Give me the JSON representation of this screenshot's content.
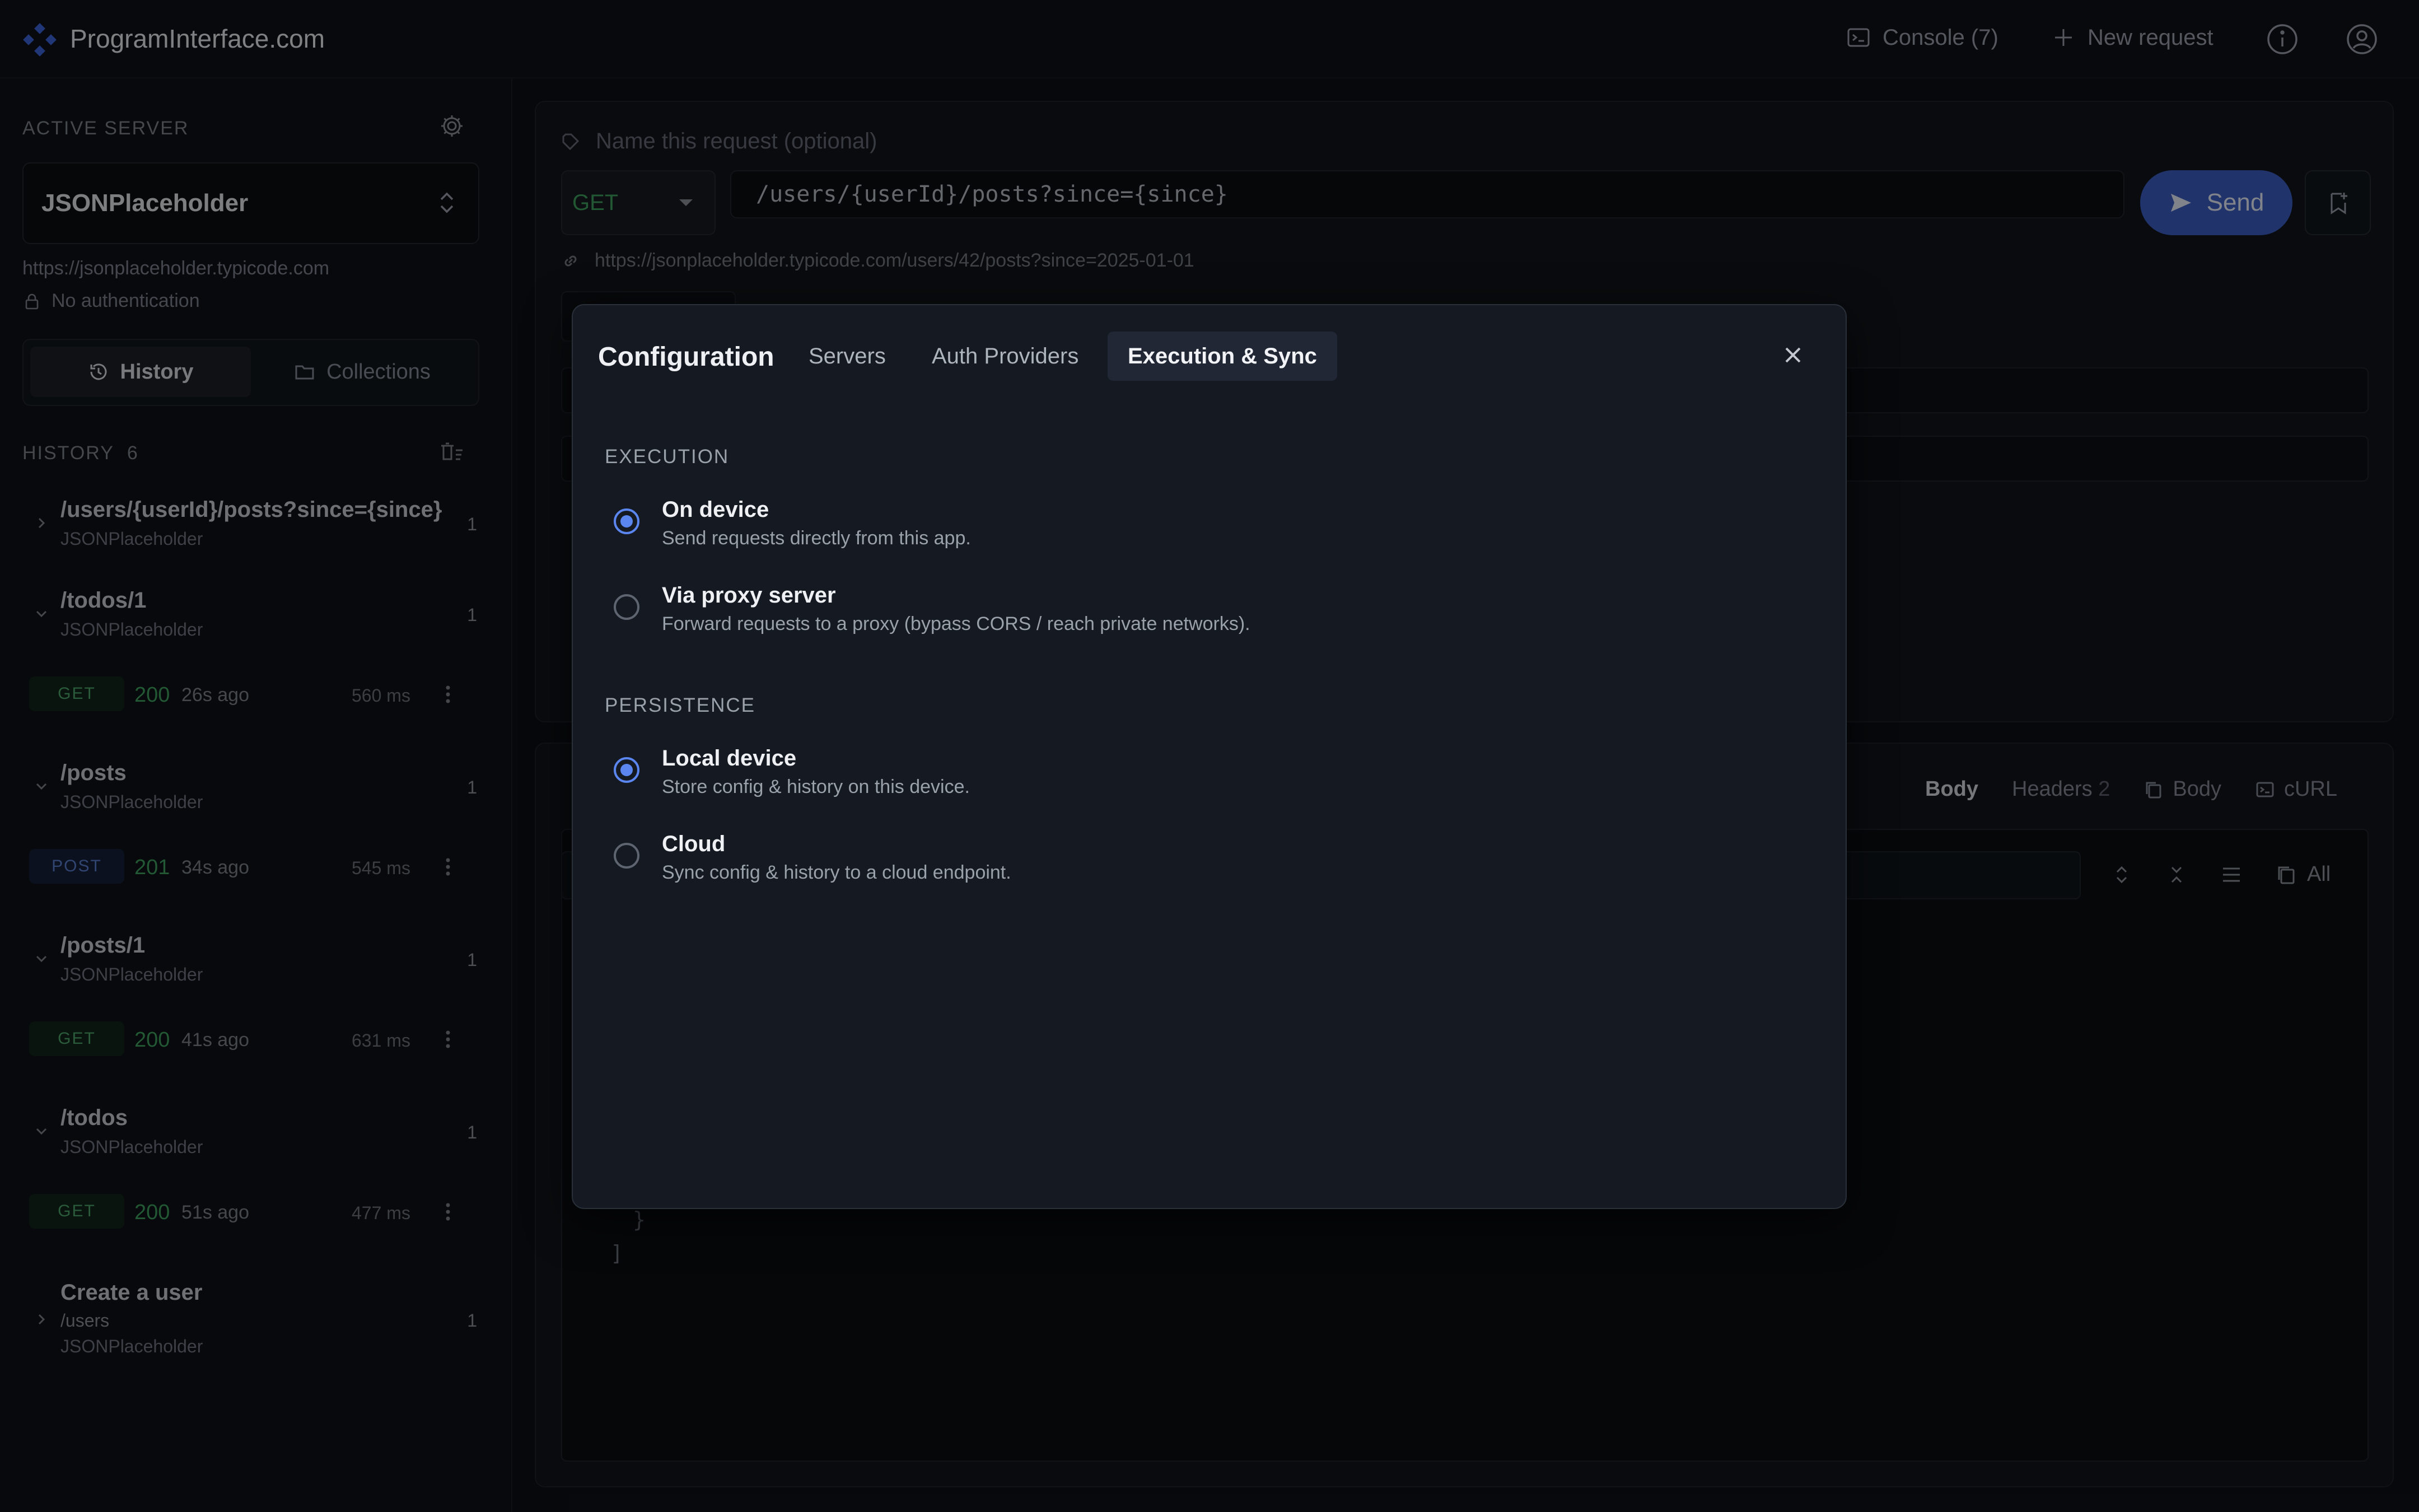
{
  "app": {
    "brand": "ProgramInterface.com",
    "console_label": "Console (7)",
    "new_request_label": "New request"
  },
  "sidebar": {
    "active_server_label": "ACTIVE SERVER",
    "server_name": "JSONPlaceholder",
    "server_url": "https://jsonplaceholder.typicode.com",
    "auth_label": "No authentication",
    "tabs": {
      "history": "History",
      "collections": "Collections"
    },
    "history_label": "HISTORY",
    "history_count": "6",
    "items": [
      {
        "title": "/users/{userId}/posts?since={since}",
        "server": "JSONPlaceholder",
        "count": "1",
        "expanded": false
      },
      {
        "title": "/todos/1",
        "server": "JSONPlaceholder",
        "count": "1",
        "expanded": true,
        "run": {
          "method": "GET",
          "status": "200",
          "age": "26s ago",
          "duration": "560 ms"
        }
      },
      {
        "title": "/posts",
        "server": "JSONPlaceholder",
        "count": "1",
        "expanded": true,
        "run": {
          "method": "POST",
          "status": "201",
          "age": "34s ago",
          "duration": "545 ms"
        }
      },
      {
        "title": "/posts/1",
        "server": "JSONPlaceholder",
        "count": "1",
        "expanded": true,
        "run": {
          "method": "GET",
          "status": "200",
          "age": "41s ago",
          "duration": "631 ms"
        }
      },
      {
        "title": "/todos",
        "server": "JSONPlaceholder",
        "count": "1",
        "expanded": true,
        "run": {
          "method": "GET",
          "status": "200",
          "age": "51s ago",
          "duration": "477 ms"
        }
      },
      {
        "title": "Create a user",
        "path": "/users",
        "server": "JSONPlaceholder",
        "count": "1",
        "expanded": false
      }
    ]
  },
  "request": {
    "name_placeholder": "Name this request (optional)",
    "method": "GET",
    "url": "/users/{userId}/posts?since={since}",
    "send_label": "Send",
    "resolved_url": "https://jsonplaceholder.typicode.com/users/42/posts?since=2025-01-01"
  },
  "response": {
    "tabs": {
      "body": "Body",
      "headers": "Headers",
      "headers_count": "2",
      "copy_body": "Body",
      "curl": "cURL"
    },
    "copy_all": "All",
    "json_tail": [
      "}",
      "]"
    ]
  },
  "dialog": {
    "title": "Configuration",
    "tabs": {
      "servers": "Servers",
      "auth": "Auth Providers",
      "exec": "Execution & Sync"
    },
    "active_tab": "exec",
    "execution": {
      "label": "EXECUTION",
      "options": [
        {
          "title": "On device",
          "desc": "Send requests directly from this app.",
          "selected": true
        },
        {
          "title": "Via proxy server",
          "desc": "Forward requests to a proxy (bypass CORS / reach private networks).",
          "selected": false
        }
      ]
    },
    "persistence": {
      "label": "PERSISTENCE",
      "options": [
        {
          "title": "Local device",
          "desc": "Store config & history on this device.",
          "selected": true
        },
        {
          "title": "Cloud",
          "desc": "Sync config & history to a cloud endpoint.",
          "selected": false
        }
      ]
    }
  },
  "colors": {
    "accent": "#5b86f0",
    "send_button": "#3b5fc4",
    "status_ok": "#3fa15e",
    "badge_get": "#4da66b",
    "badge_post": "#5a7fd1"
  },
  "icons": {
    "logo": "diamond-logo-icon",
    "console": "terminal-icon",
    "new_request": "plus-icon",
    "info": "info-icon",
    "account": "account-icon",
    "settings": "gear-icon",
    "close": "close-icon"
  }
}
